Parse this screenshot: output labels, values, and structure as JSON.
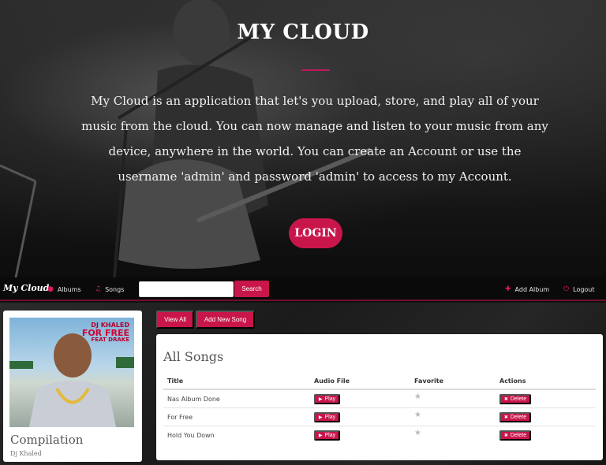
{
  "hero": {
    "title": "MY CLOUD",
    "description": "My Cloud is an application that let's you upload, store, and play all of your music from the cloud. You can now manage and listen to your music from any device, anywhere in the world. You can create an Account or use the username 'admin' and password 'admin' to access to my Account.",
    "login_label": "LOGIN"
  },
  "navbar": {
    "brand": "My Cloud",
    "albums_label": "Albums",
    "songs_label": "Songs",
    "search_placeholder": "",
    "search_label": "Search",
    "add_album_label": "Add Album",
    "logout_label": "Logout"
  },
  "album": {
    "name": "Compilation",
    "artist": "Dj Khaled",
    "cover_lines": [
      "DJ KHALED",
      "FOR FREE",
      "FEAT DRAKE"
    ]
  },
  "actions": {
    "view_all_label": "View All",
    "add_song_label": "Add New Song"
  },
  "songs": {
    "heading": "All Songs",
    "columns": [
      "Title",
      "Audio File",
      "Favorite",
      "Actions"
    ],
    "play_label": "Play",
    "delete_label": "Delete",
    "rows": [
      {
        "title": "Nas Album Done",
        "favorite": false
      },
      {
        "title": "For Free",
        "favorite": false
      },
      {
        "title": "Hold You Down",
        "favorite": false
      }
    ]
  },
  "colors": {
    "accent": "#c8164a",
    "nav_bg": "#0a0a0a",
    "panel_bg": "#ffffff"
  }
}
